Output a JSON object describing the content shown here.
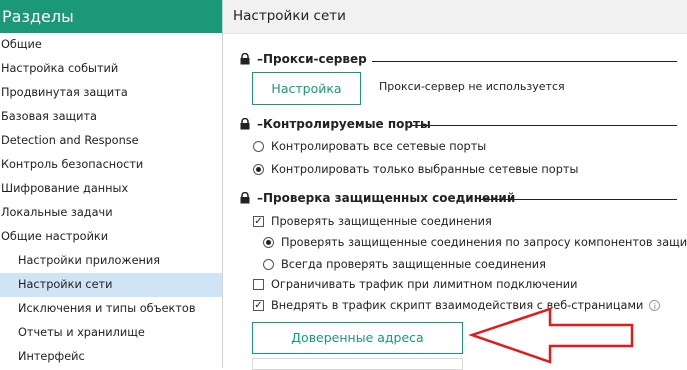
{
  "sidebar": {
    "title": "Разделы",
    "items": [
      {
        "label": "Общие"
      },
      {
        "label": "Настройка событий"
      },
      {
        "label": "Продвинутая защита"
      },
      {
        "label": "Базовая защита"
      },
      {
        "label": "Detection and Response"
      },
      {
        "label": "Контроль безопасности"
      },
      {
        "label": "Шифрование данных"
      },
      {
        "label": "Локальные задачи"
      },
      {
        "label": "Общие настройки"
      },
      {
        "label": "Настройки приложения"
      },
      {
        "label": "Настройки сети"
      },
      {
        "label": "Исключения и типы объектов"
      },
      {
        "label": "Отчеты и хранилище"
      },
      {
        "label": "Интерфейс"
      }
    ]
  },
  "main": {
    "title": "Настройки сети",
    "proxy": {
      "title": "Прокси-сервер",
      "button": "Настройка",
      "status": "Прокси-сервер не используется"
    },
    "ports": {
      "title": "Контролируемые порты",
      "options": [
        "Контролировать все сетевые порты",
        "Контролировать только выбранные сетевые порты"
      ]
    },
    "secure": {
      "title": "Проверка защищенных соединений",
      "check_secure": "Проверять защищенные соединения",
      "radio_on_request": "Проверять защищенные соединения по запросу компонентов защиты",
      "radio_always": "Всегда проверять защищенные соединения",
      "limit_traffic": "Ограничивать трафик при лимитном подключении",
      "inject_script": "Внедрять в трафик скрипт взаимодействия с веб-страницами",
      "info_glyph": "i",
      "trusted_button": "Доверенные адреса"
    }
  },
  "colors": {
    "accent": "#1a9877",
    "selected": "#cfe5f6",
    "arrow": "#e11a1a"
  }
}
